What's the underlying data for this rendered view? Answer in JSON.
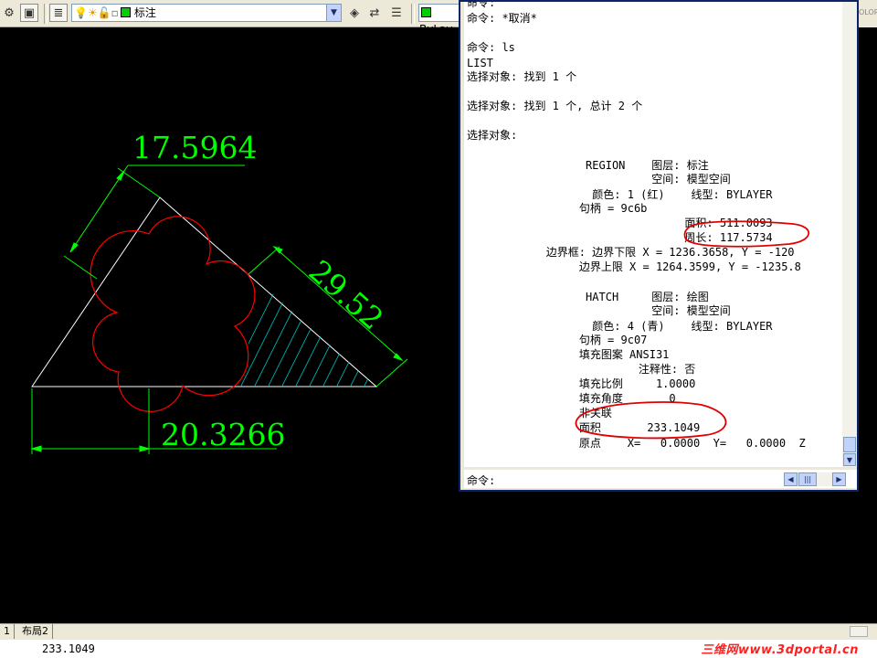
{
  "toolbar": {
    "layer_name": "标注",
    "linetype_label": "ByLay",
    "right_overflow": "OLOR"
  },
  "drawing": {
    "dimensions": [
      "17.5964",
      "29.52",
      "20.3266"
    ],
    "colors": {
      "background": "#000000",
      "dimension": "#00ff00",
      "triangle": "#ffffff",
      "region": "#ff0000",
      "hatch": "#00c8c8"
    }
  },
  "command_window": {
    "history": [
      "命令:",
      "命令: *取消*",
      "",
      "命令: ls",
      "LIST",
      "选择对象: 找到 1 个",
      "",
      "选择对象: 找到 1 个, 总计 2 个",
      "",
      "选择对象:",
      "",
      "                  REGION    图层: 标注",
      "                            空间: 模型空间",
      "                   颜色: 1 (红)    线型: BYLAYER",
      "                 句柄 = 9c6b",
      "                                 面积: 511.0093",
      "                                 周长: 117.5734",
      "            边界框: 边界下限 X = 1236.3658, Y = -120",
      "                 边界上限 X = 1264.3599, Y = -1235.8",
      "",
      "                  HATCH     图层: 绘图",
      "                            空间: 模型空间",
      "                   颜色: 4 (青)    线型: BYLAYER",
      "                 句柄 = 9c07",
      "                 填充图案 ANSI31",
      "                          注释性: 否",
      "                 填充比例     1.0000",
      "                 填充角度       0",
      "                 非关联",
      "                 面积       233.1049",
      "                 原点    X=   0.0000  Y=   0.0000  Z"
    ],
    "prompt": "命令:"
  },
  "layout_tabs": [
    "1",
    "布局2"
  ],
  "status_value": "233.1049",
  "watermark": "三维网www.3dportal.cn"
}
